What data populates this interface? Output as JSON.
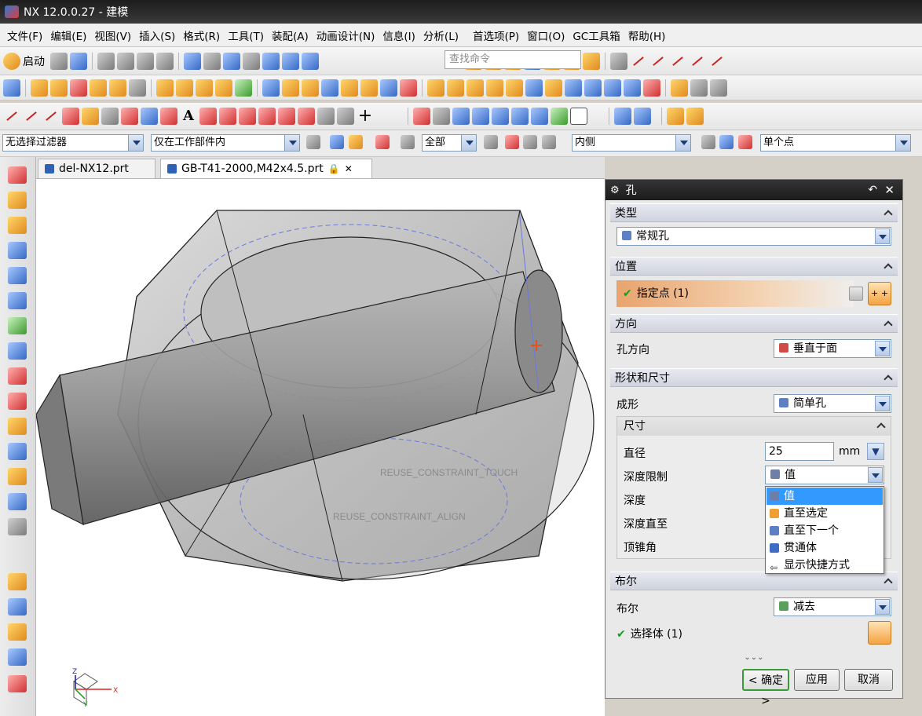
{
  "window": {
    "title": "NX 12.0.0.27 - 建模"
  },
  "menu": [
    "文件(F)",
    "编辑(E)",
    "视图(V)",
    "插入(S)",
    "格式(R)",
    "工具(T)",
    "装配(A)",
    "动画设计(N)",
    "信息(I)",
    "分析(L)",
    "首选项(P)",
    "窗口(O)",
    "GC工具箱",
    "帮助(H)"
  ],
  "toolbar": {
    "start_label": "启动",
    "search_placeholder": "查找命令"
  },
  "filterbar": {
    "type_filter": "无选择过滤器",
    "scope": "仅在工作部件内",
    "assembly": "全部",
    "intent": "内侧",
    "snap": "单个点"
  },
  "tabs": [
    {
      "label": "del-NX12.prt"
    },
    {
      "label": "GB-T41-2000,M42x4.5.prt"
    }
  ],
  "viewport": {
    "constraint_touch": "REUSE_CONSTRAINT_TOUCH",
    "constraint_align": "REUSE_CONSTRAINT_ALIGN",
    "axis_x": "X",
    "axis_y": "Y",
    "axis_z": "Z"
  },
  "dialog": {
    "title": "孔",
    "sections": {
      "type": "类型",
      "position": "位置",
      "direction": "方向",
      "shape": "形状和尺寸",
      "dims": "尺寸",
      "boolean": "布尔"
    },
    "type_value": "常规孔",
    "specify_point": "指定点 (1)",
    "hole_dir_label": "孔方向",
    "hole_dir_value": "垂直于面",
    "form_label": "成形",
    "form_value": "简单孔",
    "diameter_label": "直径",
    "diameter_value": "25",
    "diameter_unit": "mm",
    "depth_limit_label": "深度限制",
    "depth_limit_value": "值",
    "depth_label": "深度",
    "depth_to_label": "深度直至",
    "tip_angle_label": "顶锥角",
    "dropdown": [
      "值",
      "直至选定",
      "直至下一个",
      "贯通体",
      "显示快捷方式"
    ],
    "boolean_label": "布尔",
    "boolean_value": "减去",
    "select_body": "选择体 (1)",
    "ok": "< 确定 >",
    "apply": "应用",
    "cancel": "取消"
  },
  "colors": {
    "accent": "#e8a46e",
    "selection": "#3399ff",
    "check": "#1a9a1a"
  }
}
